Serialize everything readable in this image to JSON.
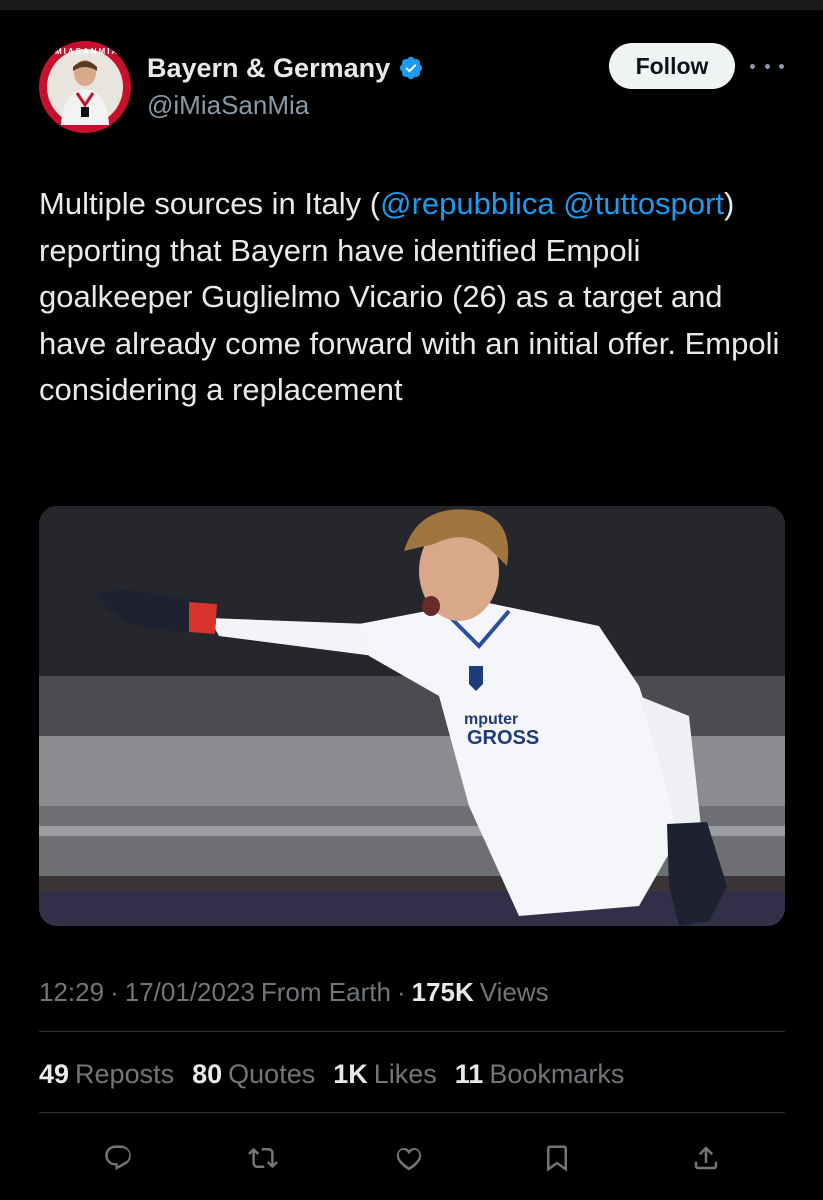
{
  "author": {
    "display_name": "Bayern & Germany",
    "handle": "@iMiaSanMia",
    "avatar_ring_text": "IMIASANMIA",
    "verified_color": "#1d9bf0"
  },
  "header": {
    "follow_label": "Follow",
    "more_icon": "more-icon"
  },
  "tweet": {
    "text_before": "Multiple sources in Italy (",
    "mention_1": "@repubblica",
    "mention_2": "@tuttosport",
    "text_after": ") reporting that Bayern have identified Empoli goalkeeper Guglielmo Vicario (26) as a target and have already come forward with an initial offer. Empoli considering a replacement",
    "mention_color": "#1d9bf0"
  },
  "media": {
    "shirt_sponsor": "mputer\nGROSS"
  },
  "meta": {
    "time": "12:29",
    "sep1": "·",
    "date": "17/01/2023",
    "source": "From Earth",
    "sep2": "·",
    "views_count": "175K",
    "views_label": "Views"
  },
  "stats": {
    "reposts_count": "49",
    "reposts_label": "Reposts",
    "quotes_count": "80",
    "quotes_label": "Quotes",
    "likes_count": "1K",
    "likes_label": "Likes",
    "bookmarks_count": "11",
    "bookmarks_label": "Bookmarks"
  },
  "actions": [
    "reply-icon",
    "repost-icon",
    "like-icon",
    "bookmark-icon",
    "share-icon"
  ]
}
